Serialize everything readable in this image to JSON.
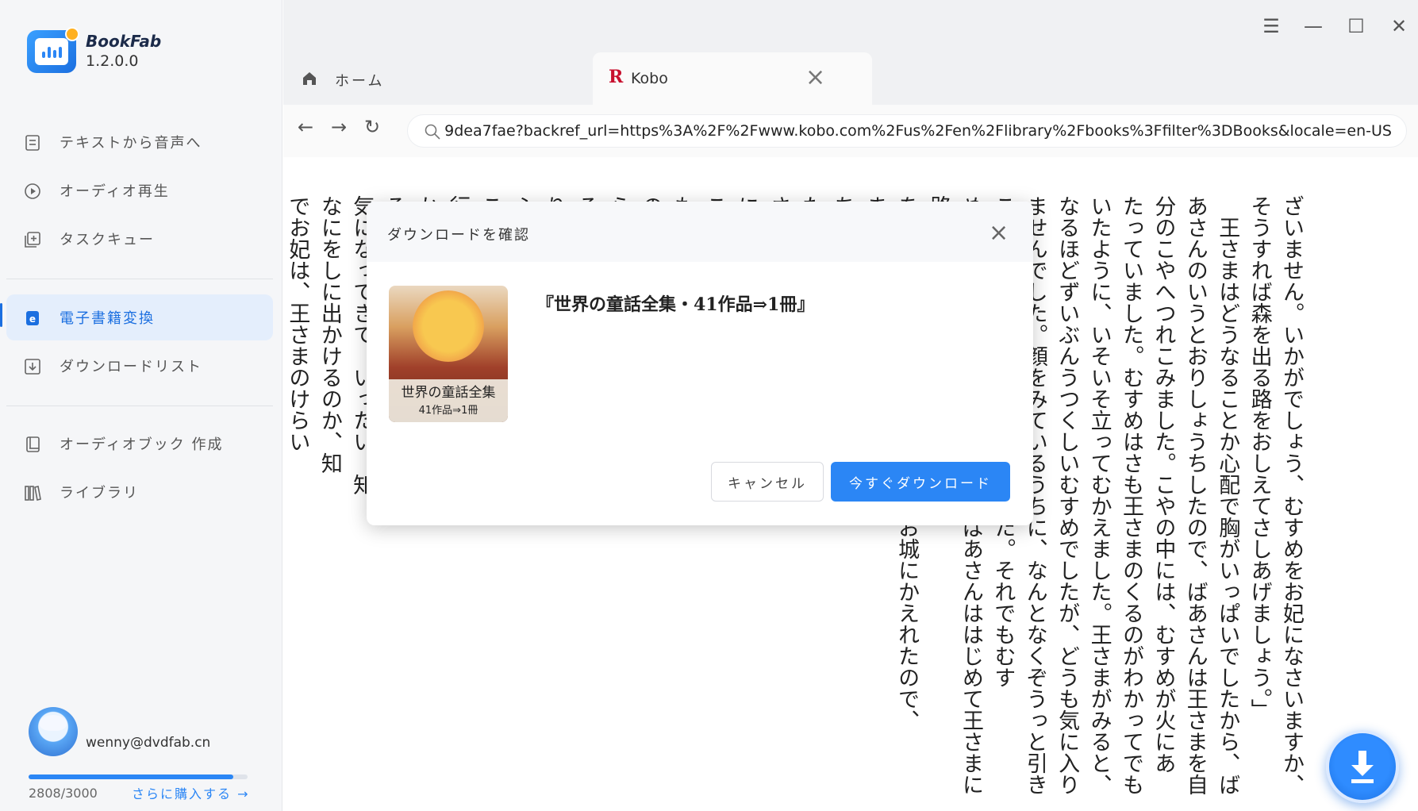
{
  "app": {
    "name": "BookFab",
    "version": "1.2.0.0"
  },
  "sidebar": {
    "items": [
      {
        "label": "テキストから音声へ",
        "icon": "document-icon"
      },
      {
        "label": "オーディオ再生",
        "icon": "play-circle-icon"
      },
      {
        "label": "タスクキュー",
        "icon": "queue-add-icon"
      },
      {
        "label": "電子書籍変換",
        "icon": "ebook-icon",
        "active": true
      },
      {
        "label": "ダウンロードリスト",
        "icon": "download-box-icon"
      },
      {
        "label": "オーディオブック 作成",
        "icon": "audiobook-icon"
      },
      {
        "label": "ライブラリ",
        "icon": "library-icon"
      }
    ]
  },
  "user": {
    "email": "wenny@dvdfab.cn",
    "quota_text": "2808/3000",
    "quota_fraction": 0.936,
    "buy_more": "さらに購入する →"
  },
  "tabs": [
    {
      "label": "ホーム",
      "icon": "home-icon"
    },
    {
      "label": "Kobo",
      "icon": "rakuten-icon",
      "icon_glyph": "R",
      "active": true
    }
  ],
  "browser": {
    "url": "9dea7fae?backref_url=https%3A%2F%2Fwww.kobo.com%2Fus%2Fen%2Flibrary%2Fbooks%3Ffilter%3DBooks&locale=en-US"
  },
  "content": {
    "columns": [
      "ざいません。いかがでしょう、むすめをお妃になさいますか、",
      "そうすれば森を出る路をおしえてさしあげましょう。」",
      "　王さまはどうなることか心配で胸がいっぱいでしたから、ば",
      "あさんのいうとおりしょうちしたので、ばあさんは王さまを自",
      "分のこやへつれこみました。こやの中には、むすめが火にあ",
      "たっていました。むすめはさも王さまのくるのがわかってでも",
      "いたように、いそいそ立ってむかえました。王さまがみると、",
      "なるほどずいぶんうつくしいむすめでしたが、どうも気に入り",
      "ませんでした。顔をみているうちに、なんとなくぞうっと引き",
      "こまれるようなきもちになりました。それでもむす",
      "めはほかのむすめとはちがって、ばあさんははじめて王さまに路",
      "をおしえたので、王さまはやっとお城にかえれたので、",
      "ました。",
      "ちど結婚なさったことがあっ",
      "た女の子がひとり、つごう七人",
      "さまは、世界じゅうのどんなも",
      "にしていました。で、こうな",
      "こどもたちにやさしくしな",
      "もされてはときづかって、森",
      "のなかに、お子たちをつれて",
      "らないようになっていて、お",
      "るのがとてもむずかしく、王",
      "りません。それを教わるの",
      "ふしぎなきどくをもつおだ",
      "このおだまきは前になげる",
      "行って、路を教えてくれまし",
      "かわいいお子たちの所へあい",
      "るすを、お妃がかぎつけるこ",
      "気になってきて、いったい、知",
      "なにをしに出かけるのか、知",
      "でお妃は、王さまのけらい"
    ]
  },
  "dialog": {
    "title": "ダウンロードを確認",
    "book_title": "『世界の童話全集・41作品⇒1冊』",
    "cover_title": "世界の童話全集",
    "cover_subtitle": "41作品⇒1冊",
    "cancel_label": "キャンセル",
    "download_label": "今すぐダウンロード"
  },
  "colors": {
    "accent": "#2b86f5",
    "sidebar_bg": "#f5f6f8",
    "active_bg": "#e4eefc"
  }
}
